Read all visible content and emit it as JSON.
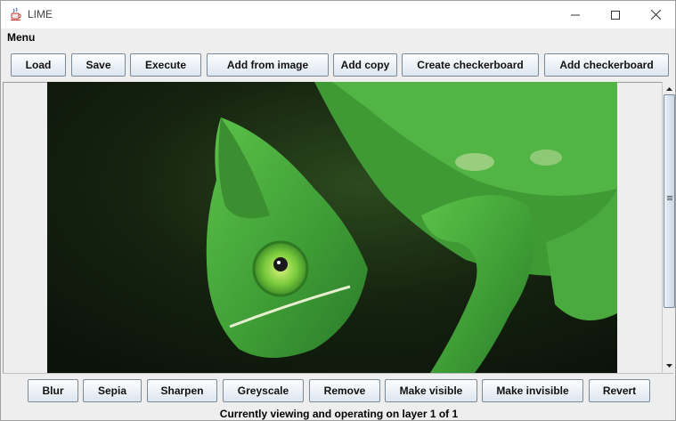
{
  "window": {
    "title": "LIME"
  },
  "menubar": {
    "menu_label": "Menu"
  },
  "toolbar": {
    "buttons": [
      {
        "label": "Load"
      },
      {
        "label": "Save"
      },
      {
        "label": "Execute"
      },
      {
        "label": "Add from image"
      },
      {
        "label": "Add copy"
      },
      {
        "label": "Create checkerboard"
      },
      {
        "label": "Add checkerboard"
      }
    ]
  },
  "filters": {
    "buttons": [
      {
        "label": "Blur"
      },
      {
        "label": "Sepia"
      },
      {
        "label": "Sharpen"
      },
      {
        "label": "Greyscale"
      },
      {
        "label": "Remove"
      },
      {
        "label": "Make visible"
      },
      {
        "label": "Make invisible"
      },
      {
        "label": "Revert"
      }
    ]
  },
  "status": {
    "text": "Currently viewing and operating on layer 1 of 1"
  },
  "icons": {
    "app": "java-cup-icon",
    "minimize": "minimize-icon",
    "maximize": "maximize-icon",
    "close": "close-icon",
    "scroll_up": "arrow-up-icon",
    "scroll_down": "arrow-down-icon"
  },
  "colors": {
    "button_border": "#7a8a99",
    "chameleon_green": "#4cae3c",
    "background_dark": "#1b2a14"
  }
}
